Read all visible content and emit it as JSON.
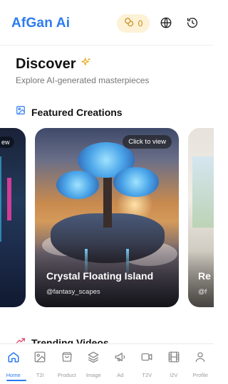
{
  "header": {
    "brand": "AfGan Ai",
    "credits": "0"
  },
  "discover": {
    "title": "Discover",
    "subtitle": "Explore AI-generated masterpieces"
  },
  "featured": {
    "title": "Featured Creations",
    "cards": [
      {
        "overlay": "ew",
        "title": "",
        "user": ""
      },
      {
        "overlay": "Click to view",
        "title": "Crystal Floating Island",
        "user": "@fantasy_scapes"
      },
      {
        "overlay": "",
        "title": "Re",
        "user": "@f"
      }
    ]
  },
  "trending": {
    "title": "Trending Videos"
  },
  "nav": {
    "items": [
      {
        "label": "Home",
        "icon": "home-icon",
        "active": true
      },
      {
        "label": "T2I",
        "icon": "image-icon",
        "active": false
      },
      {
        "label": "Product",
        "icon": "bag-icon",
        "active": false
      },
      {
        "label": "Image",
        "icon": "layers-icon",
        "active": false
      },
      {
        "label": "Ad",
        "icon": "megaphone-icon",
        "active": false
      },
      {
        "label": "T2V",
        "icon": "video-icon",
        "active": false
      },
      {
        "label": "I2V",
        "icon": "film-icon",
        "active": false
      },
      {
        "label": "Profile",
        "icon": "user-icon",
        "active": false
      }
    ]
  },
  "colors": {
    "accent": "#2b7bf0",
    "credit_bg": "#fdf1d6",
    "credit_text": "#c58a17",
    "trending_icon": "#e0436a"
  }
}
